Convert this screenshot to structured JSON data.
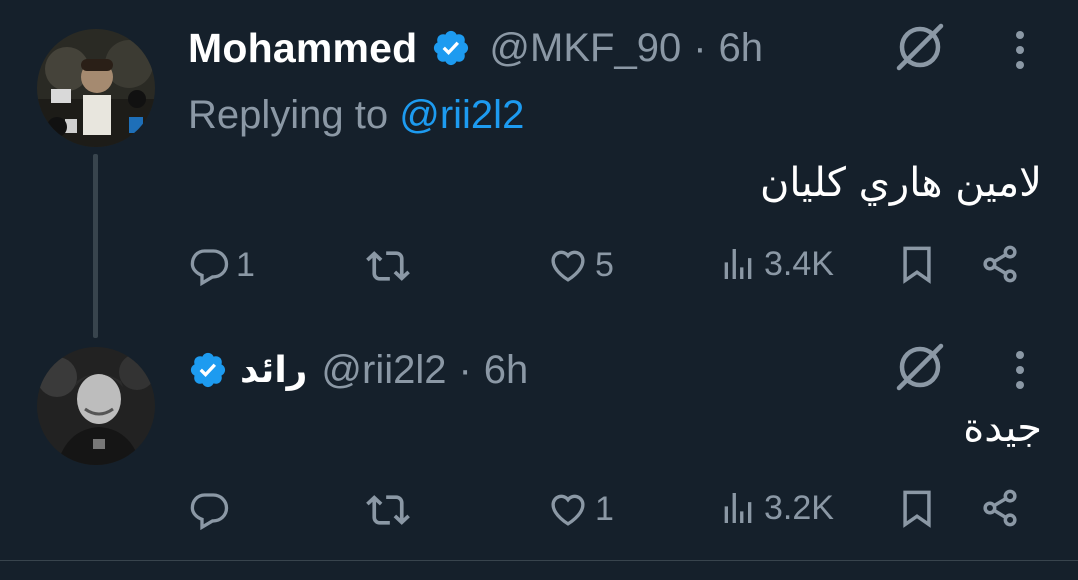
{
  "tweets": [
    {
      "display_name": "Mohammed",
      "handle": "@MKF_90",
      "separator": "·",
      "time": "6h",
      "replying_prefix": "Replying to ",
      "replying_mention": "@rii2l2",
      "text": "لامين هاري كليان",
      "replies": "1",
      "retweets": "",
      "likes": "5",
      "views": "3.4K",
      "verified": true
    },
    {
      "display_name": "رائد",
      "handle": "@rii2l2",
      "separator": "·",
      "time": "6h",
      "text": "جيدة",
      "replies": "",
      "retweets": "",
      "likes": "1",
      "views": "3.2K",
      "verified": true
    }
  ],
  "colors": {
    "background": "#15202b",
    "accent": "#1d9bf0",
    "secondary_text": "#8b98a5",
    "primary_text": "#ffffff"
  },
  "icons": [
    "verified-badge-icon",
    "grok-icon",
    "more-icon",
    "reply-icon",
    "retweet-icon",
    "like-icon",
    "views-icon",
    "bookmark-icon",
    "share-icon"
  ]
}
